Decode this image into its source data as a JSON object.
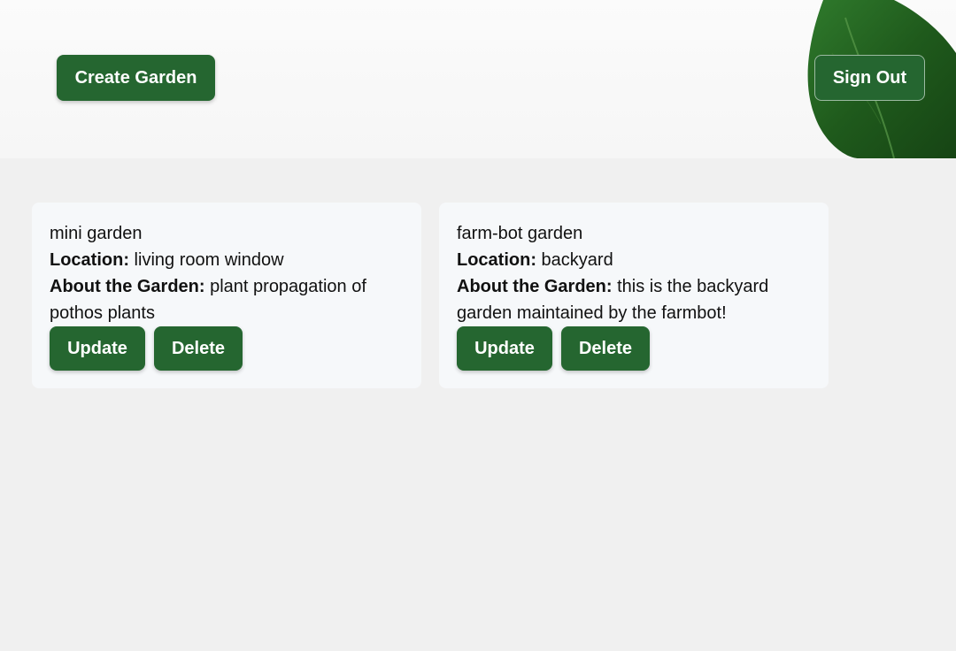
{
  "header": {
    "create_label": "Create Garden",
    "signout_label": "Sign Out"
  },
  "colors": {
    "button": "#256630",
    "card": "#f6f8fa",
    "page": "#f0f0f0"
  },
  "icons": {
    "header_decoration": "leaf-icon"
  },
  "gardens": [
    {
      "name": "mini garden",
      "location_label": "Location:",
      "location": " living room window",
      "about_label": "About the Garden:",
      "about": " plant propagation of pothos plants",
      "update_label": "Update",
      "delete_label": "Delete"
    },
    {
      "name": "farm-bot garden",
      "location_label": "Location:",
      "location": " backyard",
      "about_label": "About the Garden:",
      "about": " this is the backyard garden maintained by the farmbot!",
      "update_label": "Update",
      "delete_label": "Delete"
    }
  ]
}
